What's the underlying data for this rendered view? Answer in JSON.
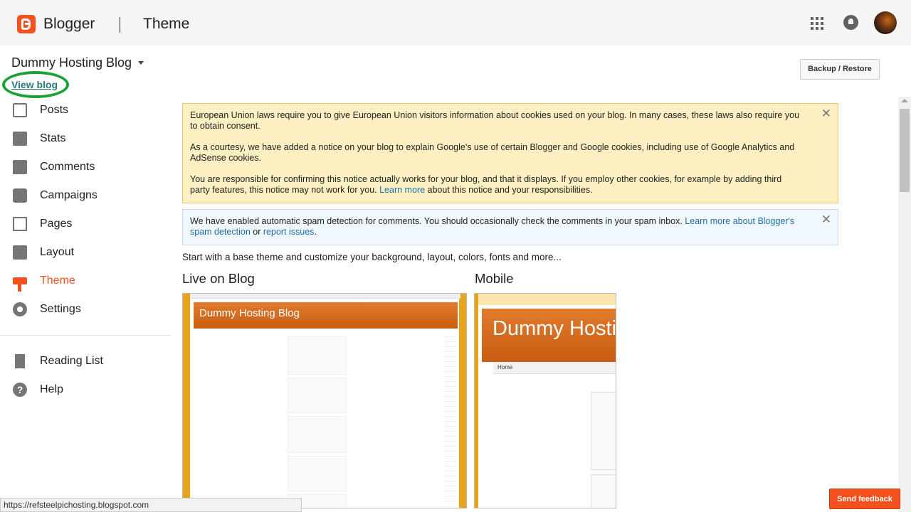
{
  "topbar": {
    "brand": "Blogger",
    "page_title": "Theme"
  },
  "sidebar": {
    "blog_name": "Dummy Hosting Blog",
    "view_blog": "View blog",
    "items": [
      {
        "label": "Posts",
        "icon": "posts-icon"
      },
      {
        "label": "Stats",
        "icon": "stats-icon"
      },
      {
        "label": "Comments",
        "icon": "comments-icon"
      },
      {
        "label": "Campaigns",
        "icon": "campaigns-icon"
      },
      {
        "label": "Pages",
        "icon": "pages-icon"
      },
      {
        "label": "Layout",
        "icon": "layout-icon"
      },
      {
        "label": "Theme",
        "icon": "theme-icon",
        "active": true
      },
      {
        "label": "Settings",
        "icon": "gear-icon"
      }
    ],
    "secondary": [
      {
        "label": "Reading List",
        "icon": "bookmark-icon"
      },
      {
        "label": "Help",
        "icon": "help-icon"
      }
    ]
  },
  "toolbar": {
    "backup_label": "Backup / Restore"
  },
  "cookie_notice": {
    "p1": "European Union laws require you to give European Union visitors information about cookies used on your blog. In many cases, these laws also require you to obtain consent.",
    "p2": "As a courtesy, we have added a notice on your blog to explain Google's use of certain Blogger and Google cookies, including use of Google Analytics and AdSense cookies.",
    "p3_before": "You are responsible for confirming this notice actually works for your blog, and that it displays. If you employ other cookies, for example by adding third party features, this notice may not work for you.",
    "p3_link": "Learn more",
    "p3_after": "about this notice and your responsibilities.",
    "close": "✕"
  },
  "spam_notice": {
    "text": "We have enabled automatic spam detection for comments. You should occasionally check the comments in your spam inbox.",
    "link1": "Learn more about Blogger's spam detection",
    "or": "or",
    "link2": "report issues",
    "end": ".",
    "close": "✕"
  },
  "main": {
    "intro": "Start with a base theme and customize your background, layout, colors, fonts and more...",
    "live_heading": "Live on Blog",
    "mobile_heading": "Mobile",
    "live_preview_title": "Dummy Hosting Blog",
    "mobile_preview_title": "Dummy Hosting Blog",
    "mobile_tab": "Home"
  },
  "footer": {
    "feedback": "Send feedback",
    "status_url": "https://refsteelpichosting.blogspot.com"
  },
  "colors": {
    "accent": "#f4511e",
    "link": "#1f6eaa",
    "view_blog_highlight": "#1aa136"
  }
}
